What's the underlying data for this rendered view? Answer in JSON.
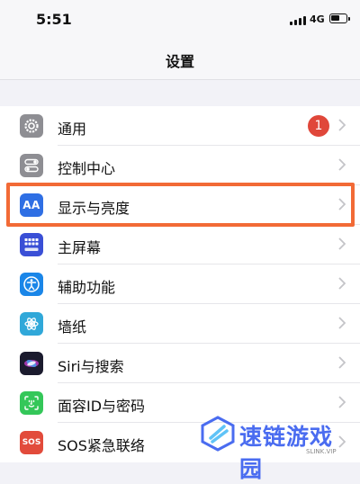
{
  "status_bar": {
    "time": "5:51",
    "network": "4G"
  },
  "nav": {
    "title": "设置"
  },
  "rows": [
    {
      "label": "通用",
      "icon": "gear-icon",
      "color": "#8e8e93",
      "badge": "1"
    },
    {
      "label": "控制中心",
      "icon": "toggles-icon",
      "color": "#8e8e93"
    },
    {
      "label": "显示与亮度",
      "icon": "text-size-icon",
      "color": "#2f6fe4",
      "icon_text": "AA"
    },
    {
      "label": "主屏幕",
      "icon": "home-grid-icon",
      "color": "#3a4fd6"
    },
    {
      "label": "辅助功能",
      "icon": "accessibility-icon",
      "color": "#1a86e8"
    },
    {
      "label": "墙纸",
      "icon": "flower-icon",
      "color": "#30a8d9"
    },
    {
      "label": "Siri与搜索",
      "icon": "siri-icon",
      "color": "#1b1b2e"
    },
    {
      "label": "面容ID与密码",
      "icon": "face-id-icon",
      "color": "#34c759"
    },
    {
      "label": "SOS紧急联络",
      "icon": "sos-icon",
      "color": "#e24b3b",
      "icon_text": "SOS"
    }
  ],
  "highlight": {
    "color": "#f26a36"
  },
  "watermark": {
    "text": "速链游戏园",
    "sub": "SLINK.VIP",
    "color": "#4a6cf0"
  }
}
